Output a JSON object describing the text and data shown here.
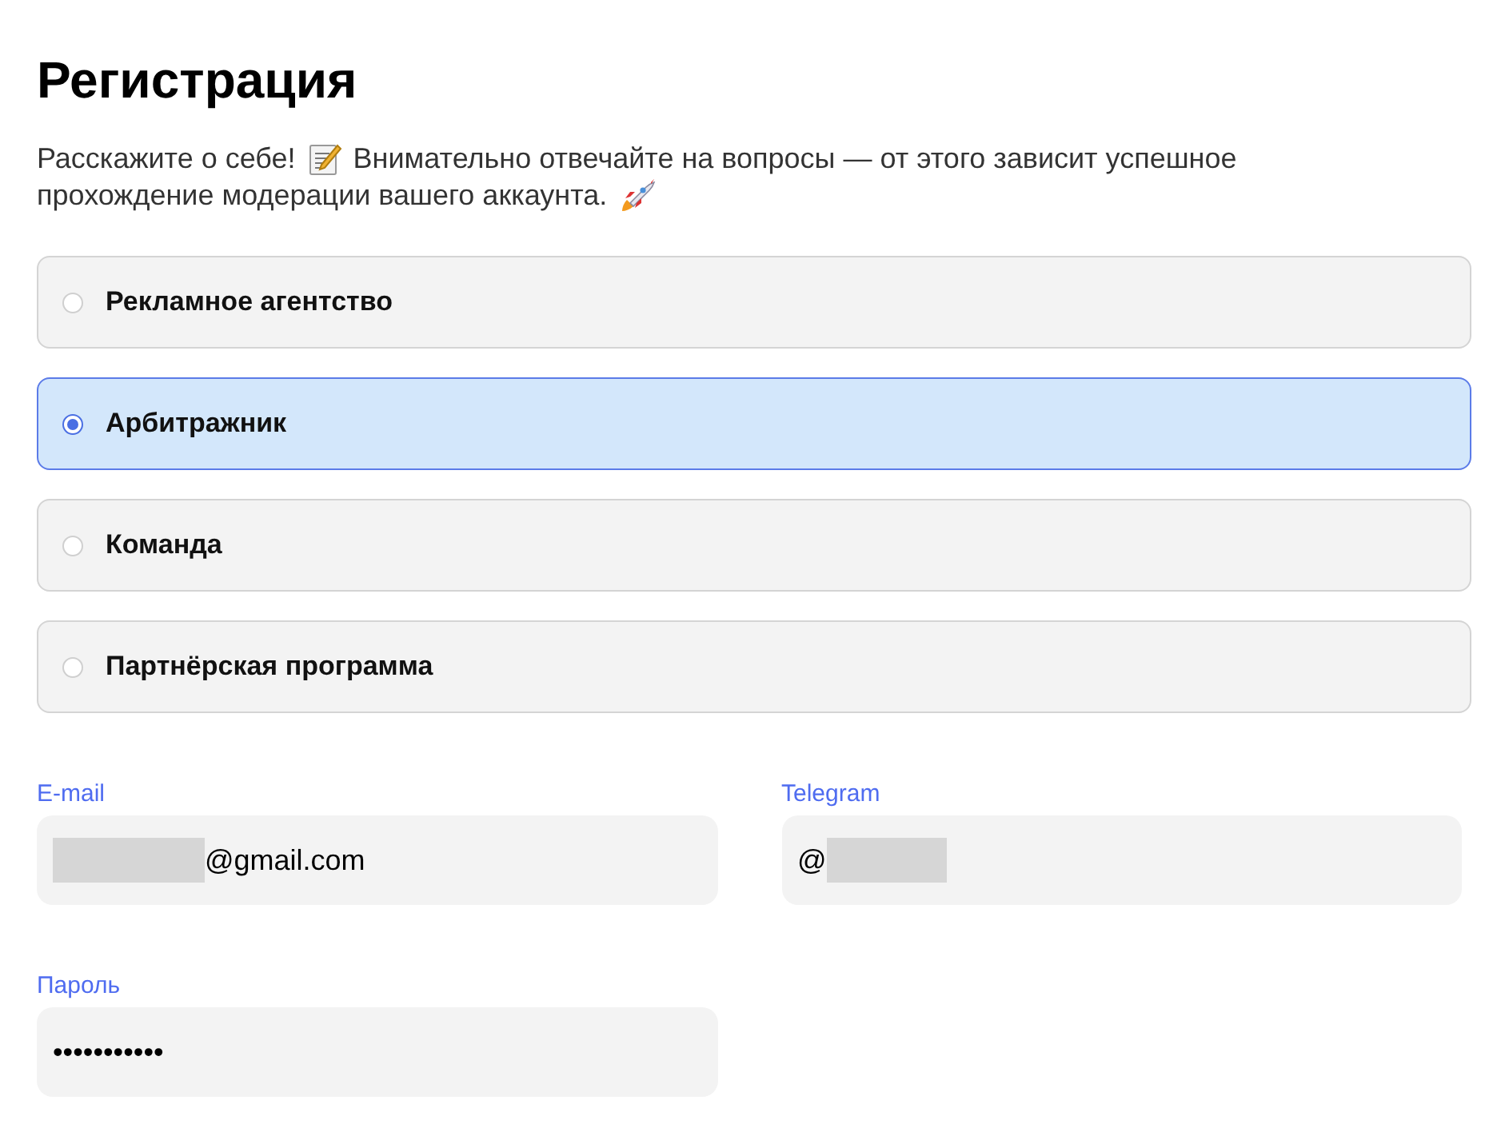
{
  "title": "Регистрация",
  "intro": {
    "line_1_start": "Расскажите о себе!",
    "line_1_end": "Внимательно отвечайте на вопросы — от этого зависит успешное",
    "line_2": "прохождение модерации вашего аккаунта."
  },
  "options": [
    {
      "label": "Рекламное агентство",
      "selected": false
    },
    {
      "label": "Арбитражник",
      "selected": true
    },
    {
      "label": "Команда",
      "selected": false
    },
    {
      "label": "Партнёрская программа",
      "selected": false
    }
  ],
  "fields": [
    {
      "label": "E-mail",
      "value": "@gmail.com",
      "redacted": true
    },
    {
      "label": "Telegram",
      "value": "@",
      "redacted": true
    },
    {
      "label": "Пароль",
      "value": "•••••••••••"
    }
  ]
}
